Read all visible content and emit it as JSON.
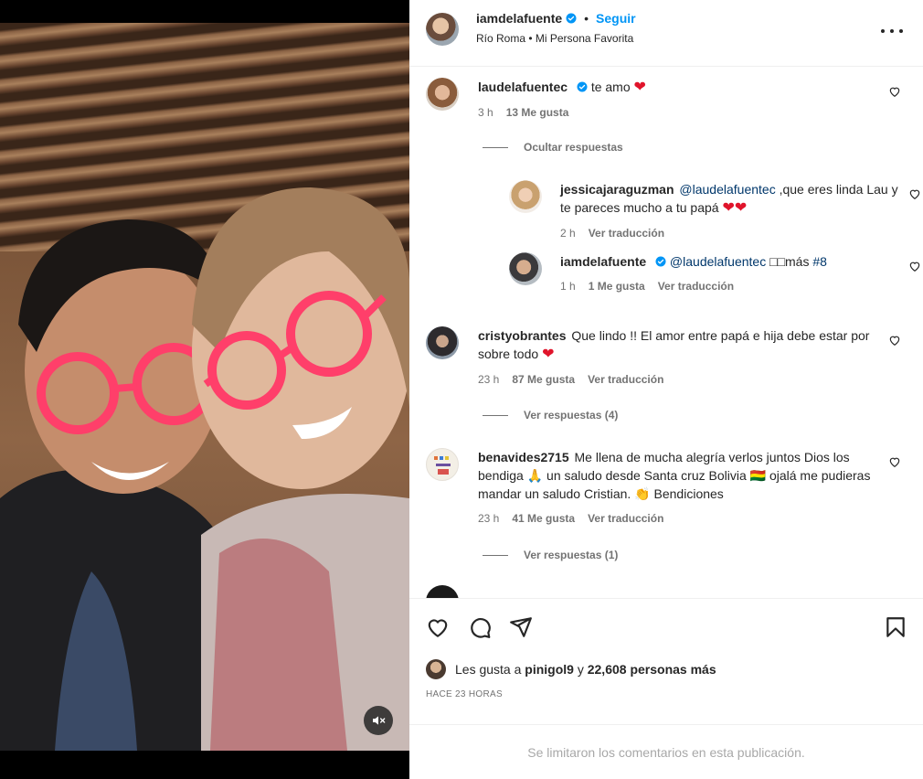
{
  "post": {
    "author": "iamdelafuente",
    "follow_label": "Seguir",
    "dot": "•",
    "song": "Río Roma • Mi Persona Favorita"
  },
  "comments": [
    {
      "user": "laudelafuentec",
      "text": "te amo",
      "emoji": "❤",
      "time": "3 h",
      "likes": "13 Me gusta"
    },
    {
      "user": "cristyobrantes",
      "text": "Que lindo !! El amor entre papá e hija debe estar por sobre todo",
      "emoji": "❤",
      "time": "23 h",
      "likes": "87 Me gusta",
      "translate": "Ver traducción",
      "view_replies": "Ver respuestas (4)"
    },
    {
      "user": "benavides2715",
      "text": "Me llena de mucha alegría verlos juntos Dios los bendiga 🙏 un saludo desde Santa cruz Bolivia 🇧🇴 ojalá me pudieras mandar un saludo Cristian. 👏 Bendiciones",
      "time": "23 h",
      "likes": "41 Me gusta",
      "translate": "Ver traducción",
      "view_replies": "Ver respuestas (1)"
    }
  ],
  "hide_replies": "Ocultar respuestas",
  "replies": [
    {
      "user": "jessicajaraguzman",
      "mention": "@laudelafuentec",
      "text": ",que eres linda Lau y te pareces mucho a tu papá",
      "emoji": "❤❤",
      "time": "2 h",
      "translate": "Ver traducción"
    },
    {
      "user": "iamdelafuente",
      "mention": "@laudelafuentec",
      "text": "□□más",
      "hashtag": "#8",
      "time": "1 h",
      "likes": "1 Me gusta",
      "translate": "Ver traducción"
    }
  ],
  "actions": {
    "liked_by_prefix": "Les gusta a",
    "liked_by_user": "pinigol9",
    "liked_by_and": "y",
    "liked_by_count": "22,608 personas más",
    "time_ago": "HACE 23 HORAS"
  },
  "footer": {
    "limited": "Se limitaron los comentarios en esta publicación."
  },
  "colors": {
    "accent": "#0095f6",
    "verified": "#0095f6",
    "heart": "#e0142b",
    "meta": "#737373"
  }
}
